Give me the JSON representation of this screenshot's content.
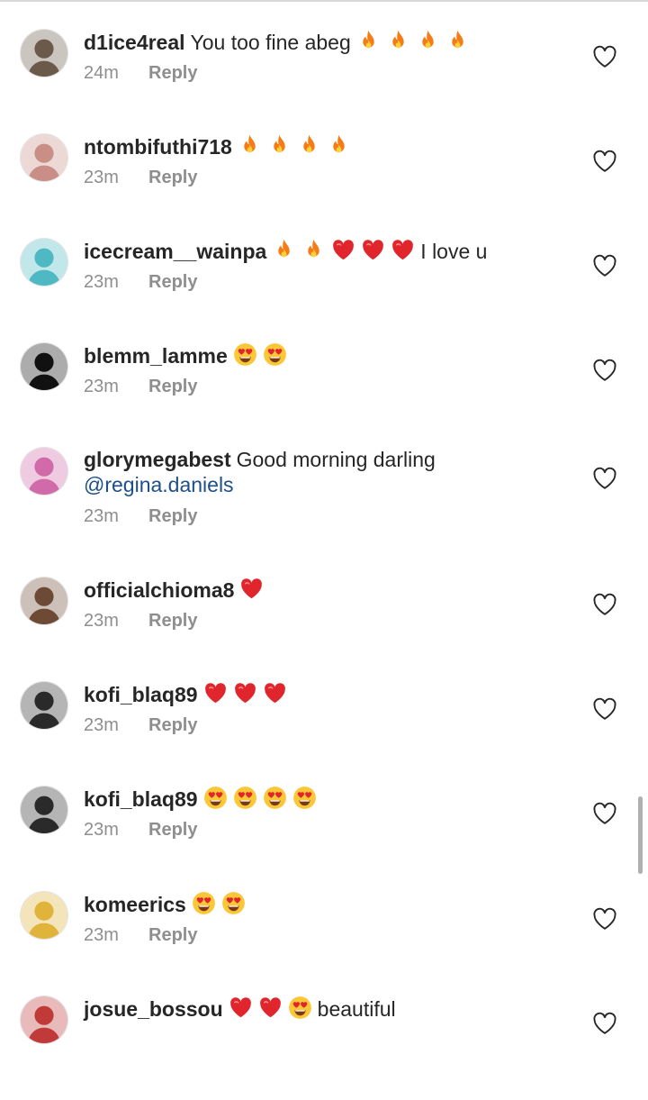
{
  "comments": [
    {
      "user": "d1ice4real",
      "text": "You too fine abeg",
      "emojis": [
        "fire",
        "fire",
        "fire",
        "fire"
      ],
      "time": "24m",
      "reply": "Reply",
      "avatar_color": "#6b5a4a"
    },
    {
      "user": "ntombifuthi718",
      "text": "",
      "emojis": [
        "fire",
        "fire",
        "fire",
        "fire"
      ],
      "time": "23m",
      "reply": "Reply",
      "avatar_color": "#c98f86"
    },
    {
      "user": "icecream__wainpa",
      "text": "I love u",
      "emojis": [
        "fire",
        "fire",
        "heart",
        "heart",
        "heart"
      ],
      "time": "23m",
      "reply": "Reply",
      "avatar_color": "#4fb9c3"
    },
    {
      "user": "blemm_lamme",
      "text": "",
      "emojis": [
        "heart-eyes",
        "heart-eyes"
      ],
      "time": "23m",
      "reply": "Reply",
      "avatar_color": "#111111"
    },
    {
      "user": "glorymegabest",
      "text": "Good morning darling",
      "mention": "@regina.daniels",
      "emojis": [],
      "time": "23m",
      "reply": "Reply",
      "avatar_color": "#d06aa8"
    },
    {
      "user": "officialchioma8",
      "text": "",
      "emojis": [
        "heart"
      ],
      "time": "23m",
      "reply": "Reply",
      "avatar_color": "#6d4a36"
    },
    {
      "user": "kofi_blaq89",
      "text": "",
      "emojis": [
        "heart",
        "heart",
        "heart"
      ],
      "time": "23m",
      "reply": "Reply",
      "avatar_color": "#2a2a2a"
    },
    {
      "user": "kofi_blaq89",
      "text": "",
      "emojis": [
        "heart-eyes",
        "heart-eyes",
        "heart-eyes",
        "heart-eyes"
      ],
      "time": "23m",
      "reply": "Reply",
      "avatar_color": "#2a2a2a"
    },
    {
      "user": "komeerics",
      "text": "",
      "emojis": [
        "heart-eyes",
        "heart-eyes"
      ],
      "time": "23m",
      "reply": "Reply",
      "avatar_color": "#e0b33a"
    },
    {
      "user": "josue_bossou",
      "text": "beautiful",
      "emojis": [
        "heart",
        "heart",
        "heart-eyes"
      ],
      "time": "",
      "reply": "",
      "avatar_color": "#c13a3a"
    }
  ],
  "colors": {
    "username": "#262626",
    "meta": "#8e8e8e",
    "mention": "#1d4f8a",
    "heart": "#e0262c",
    "fire": "#f57b16"
  },
  "icons": {
    "like": "heart-outline-icon",
    "fire": "fire-emoji-icon",
    "heart": "red-heart-emoji-icon",
    "heart-eyes": "heart-eyes-emoji-icon"
  }
}
